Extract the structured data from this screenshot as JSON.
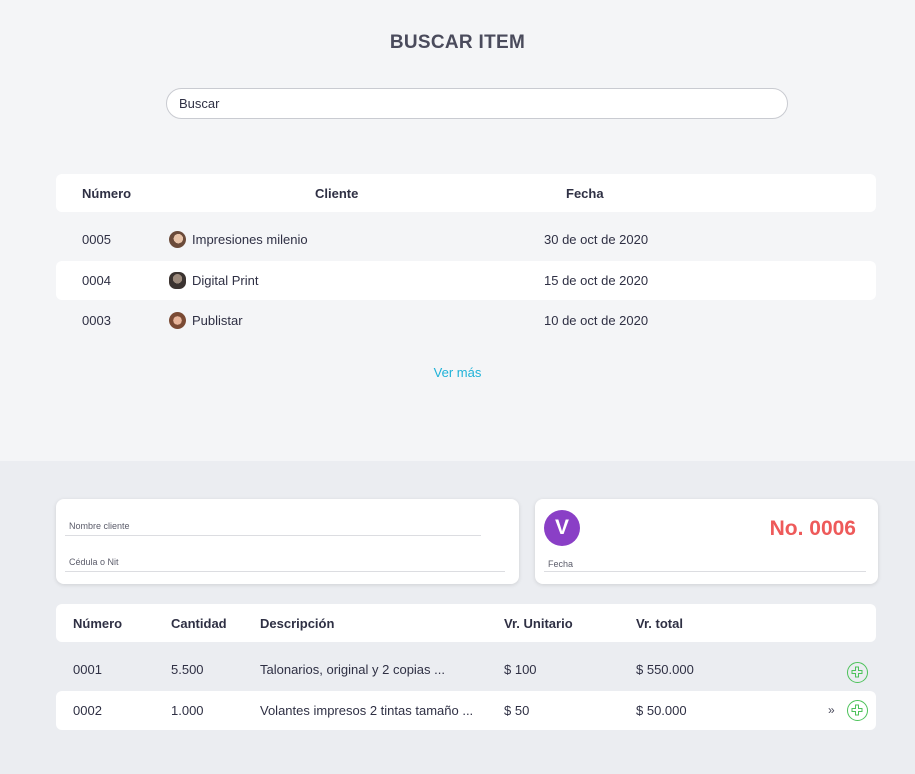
{
  "search_section": {
    "title": "BUSCAR ITEM",
    "search_placeholder": "Buscar",
    "headers": {
      "numero": "Número",
      "cliente": "Cliente",
      "fecha": "Fecha"
    },
    "rows": [
      {
        "numero": "0005",
        "cliente": "Impresiones milenio",
        "fecha": "30 de oct de 2020"
      },
      {
        "numero": "0004",
        "cliente": "Digital Print",
        "fecha": "15 de oct de 2020"
      },
      {
        "numero": "0003",
        "cliente": "Publistar",
        "fecha": "10 de oct de 2020"
      }
    ],
    "ver_mas": "Ver más"
  },
  "invoice": {
    "client_card": {
      "nombre_label": "Nombre cliente",
      "cedula_label": "Cédula o Nit"
    },
    "number_card": {
      "logo_letter": "V",
      "number": "No. 0006",
      "fecha_label": "Fecha"
    },
    "headers": {
      "numero": "Número",
      "cantidad": "Cantidad",
      "descripcion": "Descripción",
      "unitario": "Vr. Unitario",
      "total": "Vr. total"
    },
    "items": [
      {
        "numero": "0001",
        "cantidad": "5.500",
        "descripcion": "Talonarios, original y 2 copias ...",
        "unitario": "$ 100",
        "total": "$ 550.000"
      },
      {
        "numero": "0002",
        "cantidad": "1.000",
        "descripcion": "Volantes impresos 2 tintas tamaño ...",
        "unitario": "$ 50",
        "total": "$ 50.000"
      }
    ]
  },
  "colors": {
    "accent_blue": "#1fb2d8",
    "invoice_red": "#ee5a5a",
    "logo_purple": "#8a3fc6",
    "plus_green": "#4cc25a"
  }
}
